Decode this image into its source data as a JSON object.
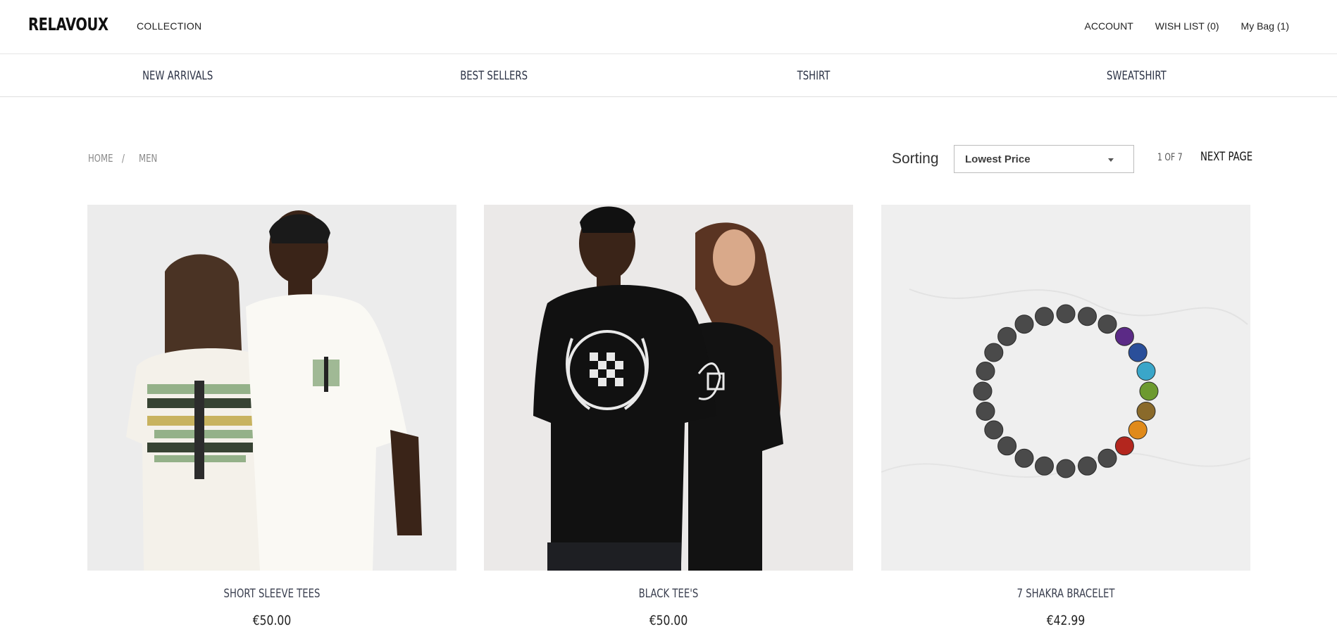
{
  "header": {
    "logo": "RELAVOUX",
    "collection_link": "COLLECTION",
    "account": "ACCOUNT",
    "wishlist": "WISH LIST (0)",
    "bag": "My Bag (1)"
  },
  "category_nav": {
    "items": [
      {
        "label": "NEW ARRIVALS"
      },
      {
        "label": "BEST SELLERS"
      },
      {
        "label": "TSHIRT"
      },
      {
        "label": "SWEATSHIRT"
      }
    ]
  },
  "breadcrumb": {
    "items": [
      "HOME",
      "MEN"
    ],
    "separator": "/"
  },
  "sorting": {
    "label": "Sorting",
    "selected": "Lowest Price"
  },
  "pagination": {
    "status": "1 OF 7",
    "next_label": "NEXT PAGE"
  },
  "products": [
    {
      "name": "SHORT SLEEVE TEES",
      "price": "€50.00"
    },
    {
      "name": "BLACK TEE'S",
      "price": "€50.00"
    },
    {
      "name": "7 SHAKRA BRACELET",
      "price": "€42.99"
    }
  ],
  "colors": {
    "text_primary": "#1f1f1f",
    "nav_text": "#2b3245",
    "divider": "#dedede",
    "image_bg": "#ececec"
  }
}
